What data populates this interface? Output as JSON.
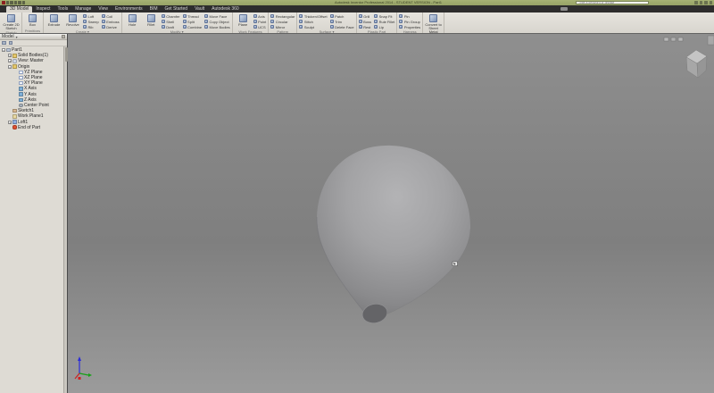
{
  "titlebar": {
    "title": "Autodesk Inventor Professional 2014 - STUDENT VERSION - Part1",
    "search_placeholder": "Type a keyword or phrase",
    "qat_icons": [
      "app",
      "save",
      "undo",
      "redo",
      "print",
      "update"
    ],
    "right_icons": [
      "favorites",
      "communication-center",
      "sign-in",
      "help"
    ]
  },
  "tabs": [
    "3D Model",
    "Inspect",
    "Tools",
    "Manage",
    "View",
    "Environments",
    "BIM",
    "Get Started",
    "Vault",
    "Autodesk 360"
  ],
  "active_tab": "3D Model",
  "ribbon": {
    "groups": [
      {
        "label": "Sketch",
        "big": [
          "Create 2D Sketch"
        ],
        "small": []
      },
      {
        "label": "Primitives",
        "big": [
          "Box"
        ],
        "small": []
      },
      {
        "label": "Create",
        "caret": true,
        "big": [
          "Extrude",
          "Revolve"
        ],
        "small": [
          "Loft",
          "Sweep",
          "Rib",
          "Coil",
          "Emboss",
          "Derive"
        ]
      },
      {
        "label": "Modify",
        "caret": true,
        "big": [
          "Hole",
          "Fillet"
        ],
        "small": [
          "Chamfer",
          "Shell",
          "Draft",
          "Thread",
          "Split",
          "Combine",
          "Move Face",
          "Copy Object",
          "Move Bodies"
        ]
      },
      {
        "label": "Work Features",
        "big": [
          "Plane"
        ],
        "small": [
          "Axis",
          "Point",
          "UCS"
        ]
      },
      {
        "label": "Pattern",
        "big": [],
        "small": [
          "Rectangular",
          "Circular",
          "Mirror"
        ]
      },
      {
        "label": "Surface",
        "caret": true,
        "big": [],
        "small": [
          "Thicken/Offset",
          "Stitch",
          "Sculpt",
          "Patch",
          "Trim",
          "Delete Face"
        ]
      },
      {
        "label": "Plastic Part",
        "big": [],
        "small": [
          "Grill",
          "Boss",
          "Rest",
          "Snap Fit",
          "Rule Fillet",
          "Lip"
        ]
      },
      {
        "label": "Harness",
        "big": [],
        "small": [
          "Pin",
          "Pin Group",
          "Properties"
        ]
      },
      {
        "label": "Convert",
        "big": [
          "Convert to Sheet Metal"
        ],
        "small": []
      }
    ]
  },
  "browser": {
    "header": "Model",
    "tree": [
      {
        "label": "Part1",
        "depth": 0,
        "icon": "part",
        "exp": "minus"
      },
      {
        "label": "Solid Bodies(1)",
        "depth": 1,
        "icon": "folder",
        "exp": "plus"
      },
      {
        "label": "View: Master",
        "depth": 1,
        "icon": "eye",
        "exp": "plus"
      },
      {
        "label": "Origin",
        "depth": 1,
        "icon": "folder",
        "exp": "minus"
      },
      {
        "label": "YZ Plane",
        "depth": 2,
        "icon": "plane"
      },
      {
        "label": "XZ Plane",
        "depth": 2,
        "icon": "plane"
      },
      {
        "label": "XY Plane",
        "depth": 2,
        "icon": "plane"
      },
      {
        "label": "X Axis",
        "depth": 2,
        "icon": "axis"
      },
      {
        "label": "Y Axis",
        "depth": 2,
        "icon": "axis"
      },
      {
        "label": "Z Axis",
        "depth": 2,
        "icon": "axis"
      },
      {
        "label": "Center Point",
        "depth": 2,
        "icon": "point"
      },
      {
        "label": "Sketch1",
        "depth": 1,
        "icon": "sketch"
      },
      {
        "label": "Work Plane1",
        "depth": 1,
        "icon": "workplane"
      },
      {
        "label": "Loft1",
        "depth": 1,
        "icon": "loft",
        "exp": "plus"
      },
      {
        "label": "End of Part",
        "depth": 1,
        "icon": "eop"
      }
    ]
  },
  "viewport": {
    "elements": [
      "view-cube",
      "loft-teardrop-model",
      "origin-triad",
      "select-cursor"
    ]
  },
  "colors": {
    "titlebar_green": "#a6b274",
    "tab_bar_bg": "#2d2d2d",
    "ribbon_bg": "#d8d5ce",
    "browser_bg": "#dedbd4",
    "viewport_top": "#8f8f8f",
    "viewport_mid": "#7f7f7f",
    "viewport_bottom": "#9b9b9b",
    "model_light": "#b3b3b5",
    "model_dark": "#7d7d7f",
    "axis_blue": "#2c2cd8",
    "axis_green": "#18a018",
    "axis_red": "#d02020"
  }
}
